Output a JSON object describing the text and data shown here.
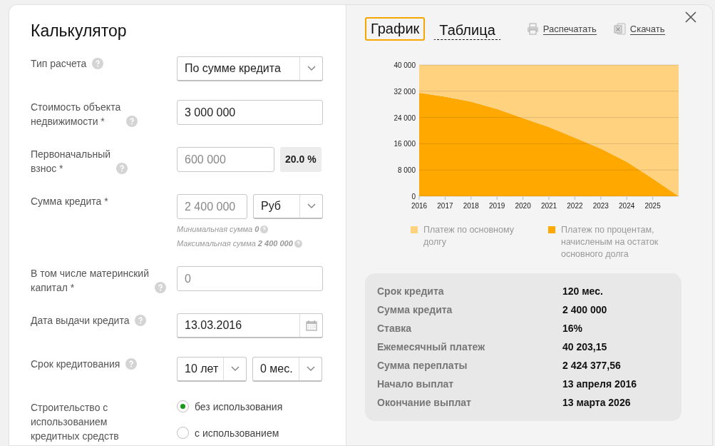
{
  "calculator": {
    "title": "Калькулятор",
    "fields": [
      {
        "kind": "select",
        "label": [
          "Тип расчета"
        ],
        "help": true,
        "value": "По сумме кредита"
      },
      {
        "kind": "input",
        "label": [
          "Стоимость объекта",
          "недвижимости *"
        ],
        "help": true,
        "value": "3 000 000"
      },
      {
        "kind": "input_badge",
        "label": [
          "Первоначальный",
          "взнос *"
        ],
        "help": true,
        "placeholder": "600 000",
        "badge": "20.0 %"
      },
      {
        "kind": "input_select",
        "label": [
          "Сумма кредита *"
        ],
        "help": false,
        "placeholder": "2 400 000",
        "unit": "Руб",
        "hints": [
          "Минимальная сумма **0**",
          "Максимальная сумма **2 400 000**"
        ]
      },
      {
        "kind": "input",
        "label": [
          "В том числе материнский",
          "капитал *"
        ],
        "help": true,
        "placeholder": "0"
      },
      {
        "kind": "date",
        "label": [
          "Дата выдачи кредита"
        ],
        "help": true,
        "value": "13.03.2016"
      },
      {
        "kind": "term",
        "label": [
          "Срок кредитования"
        ],
        "help": true,
        "years": "10 лет",
        "months": "0 мес."
      },
      {
        "kind": "radio",
        "label": [
          "Строительство с",
          "использованием",
          "кредитных средств"
        ],
        "help": false,
        "options": [
          {
            "label": "без использования",
            "selected": true
          },
          {
            "label": "с использованием",
            "selected": false
          }
        ]
      }
    ]
  },
  "results": {
    "tabs": [
      {
        "label": "График",
        "selected": true
      },
      {
        "label": "Таблица",
        "selected": false
      }
    ],
    "actions": [
      {
        "kind": "print",
        "label": "Распечатать"
      },
      {
        "kind": "excel",
        "label": "Скачать"
      }
    ],
    "chart_data": {
      "type": "area",
      "stacked": true,
      "x": [
        2016,
        2017,
        2018,
        2019,
        2020,
        2021,
        2022,
        2023,
        2024,
        2025,
        2026
      ],
      "series": [
        {
          "name": "Платеж по процентам, начисленым на остаток основного долга",
          "color": "#ffa800",
          "values": [
            31500,
            30300,
            28800,
            26600,
            23800,
            21100,
            17800,
            14500,
            10500,
            5400,
            0
          ]
        },
        {
          "name": "Платеж по основному долгу",
          "color": "#ffd27f",
          "values": [
            8500,
            9700,
            11200,
            13400,
            16200,
            18900,
            22200,
            25500,
            29500,
            34600,
            40000
          ]
        }
      ],
      "grid": true,
      "ylim": [
        0,
        40000
      ],
      "yticks": [
        {
          "value": 0,
          "label": "0"
        },
        {
          "value": 8000,
          "label": "8 000"
        },
        {
          "value": 16000,
          "label": "16 000"
        },
        {
          "value": 24000,
          "label": "24 000"
        },
        {
          "value": 32000,
          "label": "32 000"
        },
        {
          "value": 40000,
          "label": "40 000"
        }
      ],
      "xticks": [
        2016,
        2017,
        2018,
        2019,
        2020,
        2021,
        2022,
        2023,
        2024,
        2025
      ],
      "xlim": [
        2016,
        2026
      ]
    },
    "summary": [
      {
        "label": "Срок кредита",
        "value": "120 мес."
      },
      {
        "label": "Сумма кредита",
        "value": "2 400 000"
      },
      {
        "label": "Ставка",
        "value": "16%"
      },
      {
        "label": "Ежемесячный платеж",
        "value": "40 203,15"
      },
      {
        "label": "Сумма переплаты",
        "value": "2 424 377,56"
      },
      {
        "label": "Начало выплат",
        "value": "13 апреля 2016"
      },
      {
        "label": "Окончание выплат",
        "value": "13 марта 2026"
      }
    ]
  }
}
